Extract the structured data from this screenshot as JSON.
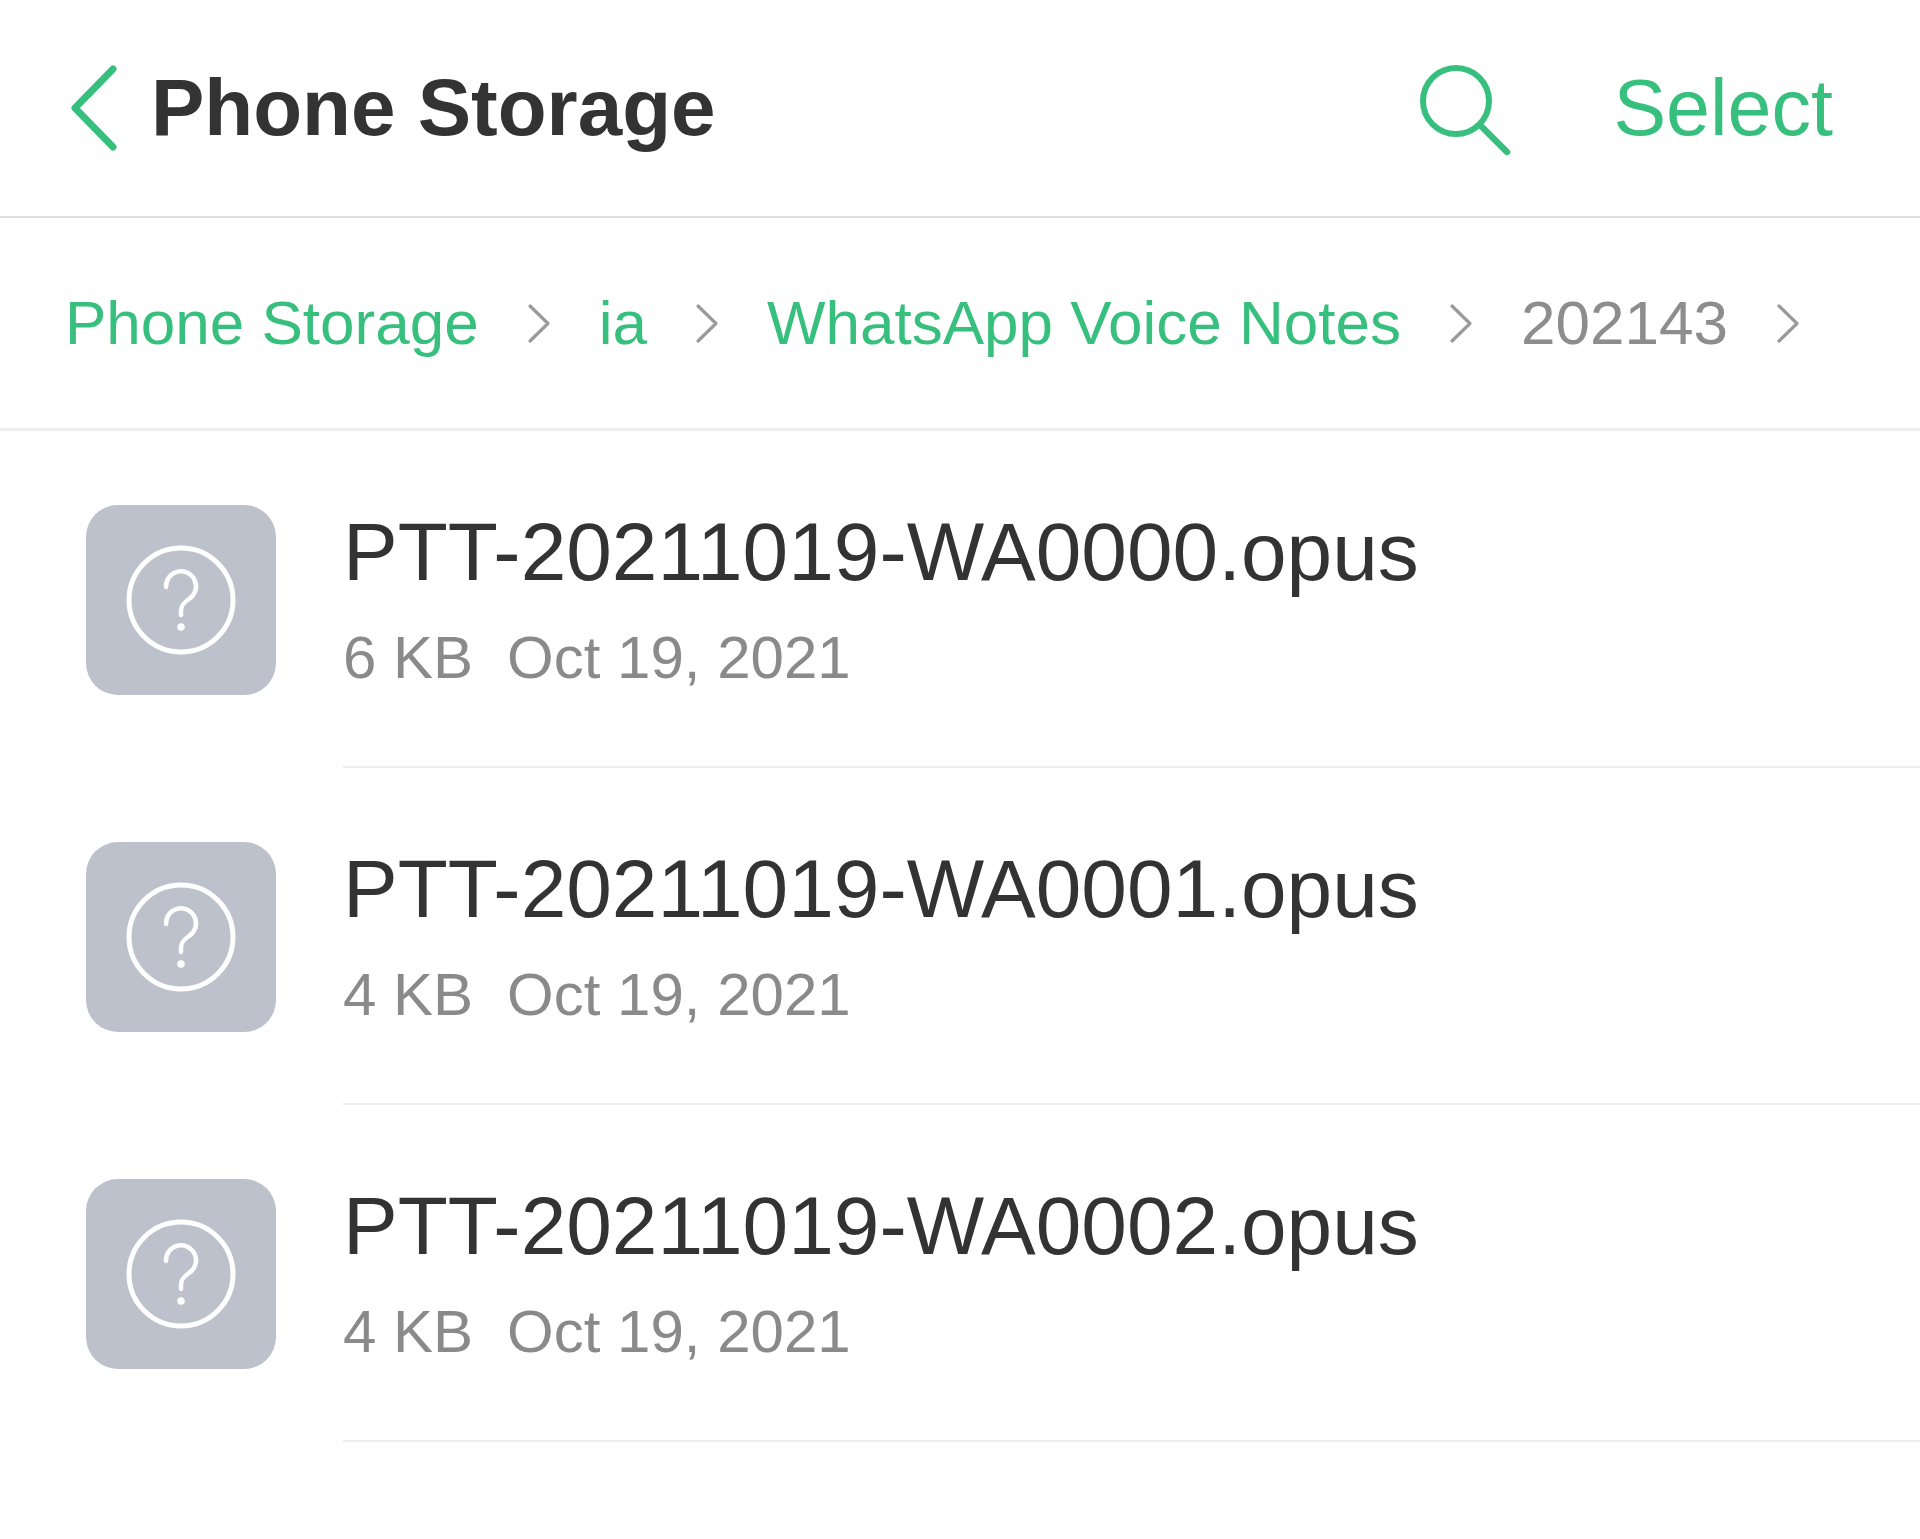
{
  "header": {
    "title": "Phone Storage",
    "action": "Select"
  },
  "breadcrumb": [
    {
      "label": "Phone Storage",
      "current": false
    },
    {
      "label": "ia",
      "current": false
    },
    {
      "label": "WhatsApp Voice Notes",
      "current": false
    },
    {
      "label": "202143",
      "current": true
    }
  ],
  "files": [
    {
      "name": "PTT-20211019-WA0000.opus",
      "size": "6 KB",
      "date": "Oct 19, 2021"
    },
    {
      "name": "PTT-20211019-WA0001.opus",
      "size": "4 KB",
      "date": "Oct 19, 2021"
    },
    {
      "name": "PTT-20211019-WA0002.opus",
      "size": "4 KB",
      "date": "Oct 19, 2021"
    }
  ]
}
